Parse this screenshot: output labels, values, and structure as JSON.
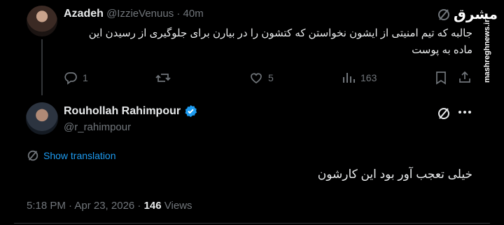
{
  "reply_tweet": {
    "display_name": "Azadeh",
    "handle": "@IzzieVenuus",
    "separator": "·",
    "time_ago": "40m",
    "text_line1": "جالبه که تیم امنیتی از ایشون نخواستن که کتشون را در بیارن برای جلوگیری از رسیدن این",
    "text_line2": "ماده به پوست",
    "actions": {
      "replies": "1",
      "reposts": "",
      "likes": "5",
      "views": "163"
    }
  },
  "main_tweet": {
    "display_name": "Rouhollah Rahimpour",
    "handle": "@r_rahimpour",
    "verified": true,
    "show_translation_label": "Show translation",
    "text": "خیلی تعجب آور بود این کارشون",
    "timestamp": "5:18 PM · Apr 23, 2026 · ",
    "views_count": "146",
    "views_label": " Views"
  },
  "watermark": {
    "site": "mashreghnews.ir",
    "logo_text": "مشرق"
  },
  "colors": {
    "background": "#000000",
    "text": "#e7e9ea",
    "muted": "#71767b",
    "accent": "#1d9bf0"
  }
}
